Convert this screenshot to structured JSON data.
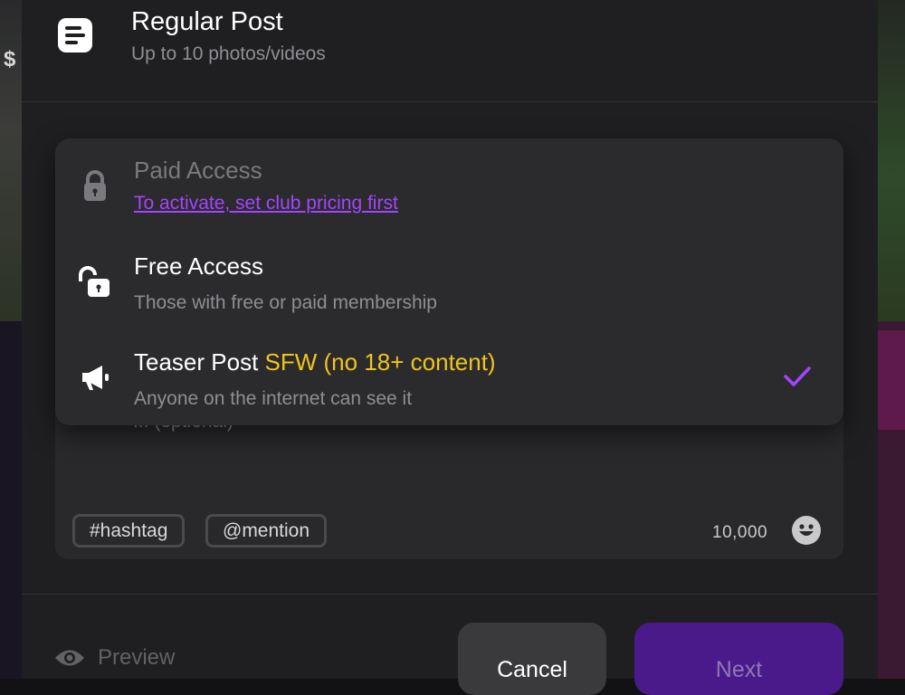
{
  "background": {
    "price_fragment": "$"
  },
  "header": {
    "icon": "post-text-icon",
    "title": "Regular Post",
    "subtitle": "Up to 10 photos/videos"
  },
  "access_menu": {
    "options": [
      {
        "icon": "lock-icon",
        "title": "Paid Access",
        "link": "To activate, set club pricing first",
        "enabled": false,
        "selected": false
      },
      {
        "icon": "unlock-icon",
        "title": "Free Access",
        "subtitle": "Those with free or paid membership",
        "enabled": true,
        "selected": false
      },
      {
        "icon": "megaphone-icon",
        "title": "Teaser Post",
        "badge": "SFW (no 18+ content)",
        "subtitle": "Anyone on the internet can see it",
        "enabled": true,
        "selected": true
      }
    ],
    "check_icon": "check-icon",
    "colors": {
      "accent": "#a544ff",
      "badge": "#f0c419"
    }
  },
  "composer": {
    "placeholder_fragment": "... (optional)",
    "chips": [
      "#hashtag",
      "@mention"
    ],
    "char_limit": "10,000",
    "emoji_icon": "emoji-icon"
  },
  "footer": {
    "preview_icon": "eye-icon",
    "preview_label": "Preview",
    "cancel_label": "Cancel",
    "next_label": "Next",
    "colors": {
      "next_bg": "#4a1a8a"
    }
  }
}
